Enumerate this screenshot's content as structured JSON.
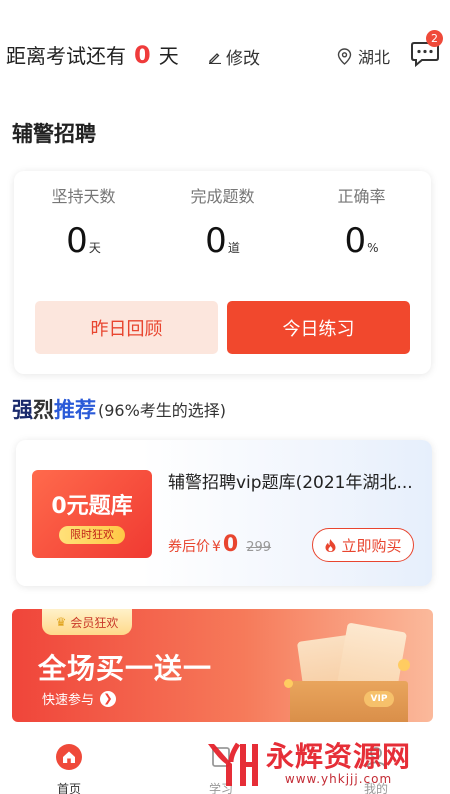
{
  "header": {
    "countdown_prefix": "距离考试还有",
    "countdown_days": "0",
    "countdown_suffix": "天",
    "edit_label": "修改",
    "location": "湖北",
    "message_badge": "2"
  },
  "section_title": "辅警招聘",
  "stats": [
    {
      "label": "坚持天数",
      "value": "0",
      "unit": "天"
    },
    {
      "label": "完成题数",
      "value": "0",
      "unit": "道"
    },
    {
      "label": "正确率",
      "value": "0",
      "unit": "%"
    }
  ],
  "buttons": {
    "review": "昨日回顾",
    "practice": "今日练习"
  },
  "recommend": {
    "title_char1": "强",
    "title_char2": "烈",
    "title_char3": "推荐",
    "subtitle": "(96%考生的选择)"
  },
  "product": {
    "thumb_title": "0元题库",
    "thumb_tag": "限时狂欢",
    "title": "辅警招聘vip题库(2021年湖北...",
    "price_label": "券后价",
    "currency": "¥",
    "price": "0",
    "original_price": "299",
    "buy_label": "立即购买"
  },
  "banner": {
    "tag": "会员狂欢",
    "headline": "全场买一送一",
    "link": "快速参与",
    "vip": "VIP"
  },
  "tabbar": {
    "tabs": [
      {
        "label": "首页",
        "active": true
      },
      {
        "label": "学习",
        "active": false
      },
      {
        "label": "我的",
        "active": false
      }
    ]
  },
  "watermark": {
    "name": "永辉资源网",
    "url": "www.yhkjjj.com"
  },
  "colors": {
    "accent": "#f1482d",
    "accent_light": "#fce6dd",
    "highlight_red": "#ef3b3b"
  }
}
